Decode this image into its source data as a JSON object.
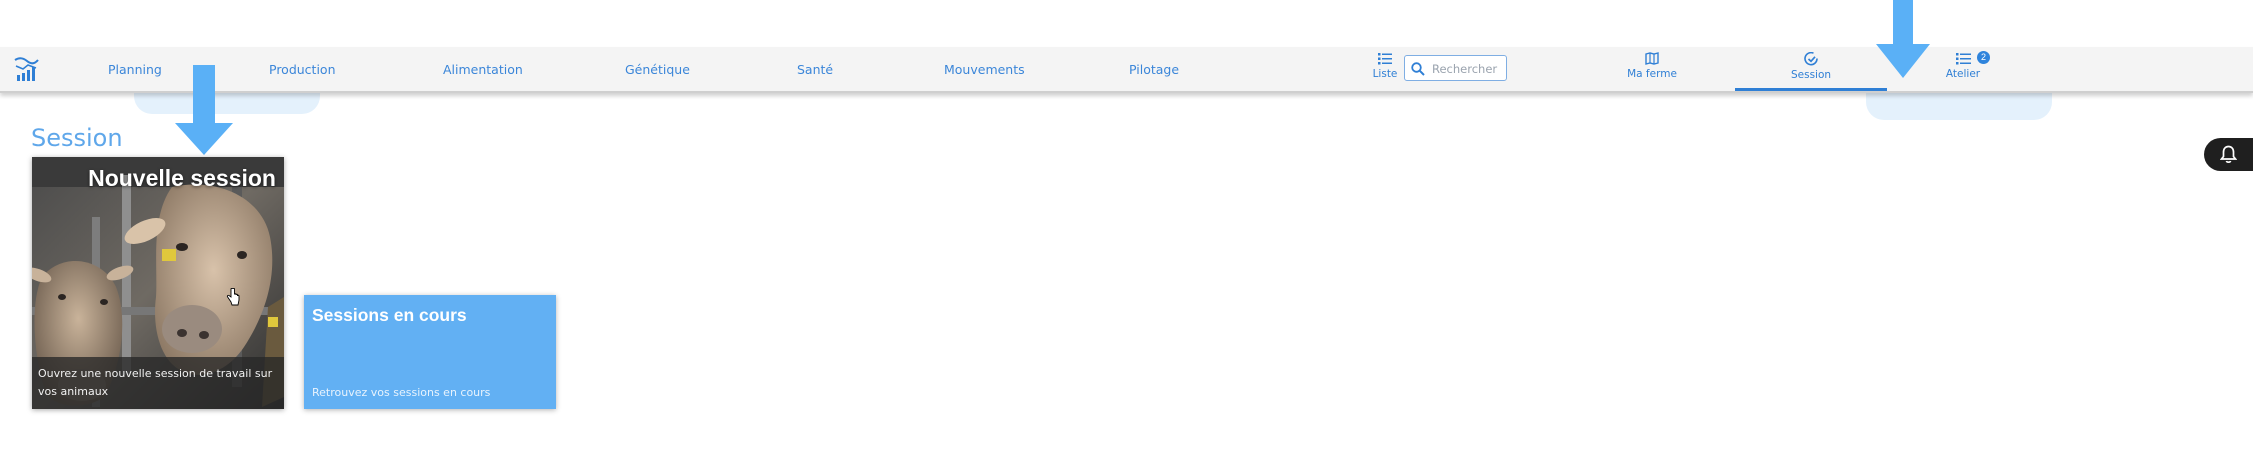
{
  "nav": {
    "links": [
      "Planning",
      "Production",
      "Alimentation",
      "Génétique",
      "Santé",
      "Mouvements",
      "Pilotage"
    ],
    "liste_label": "Liste",
    "search_placeholder": "Rechercher",
    "ma_ferme_label": "Ma ferme",
    "session_label": "Session",
    "atelier_label": "Atelier",
    "atelier_badge": "2",
    "active_tab": "Session"
  },
  "page": {
    "title": "Session"
  },
  "cards": {
    "new_session": {
      "title": "Nouvelle session",
      "description": "Ouvrez une nouvelle session de travail sur vos animaux"
    },
    "current_sessions": {
      "title": "Sessions en cours",
      "description": "Retrouvez vos sessions en cours"
    }
  },
  "icons": {
    "logo": "farm-chart-logo",
    "liste": "list-icon",
    "search": "search-icon",
    "ma_ferme": "map-icon",
    "session": "check-circle-icon",
    "atelier": "list-icon",
    "bell": "bell-icon",
    "cursor": "hand-cursor-icon"
  },
  "colors": {
    "accent": "#2f7fd5",
    "card_blue": "#62b0f3",
    "hint_arrow": "#5ab0f6",
    "title_light": "#5fa7ea"
  }
}
